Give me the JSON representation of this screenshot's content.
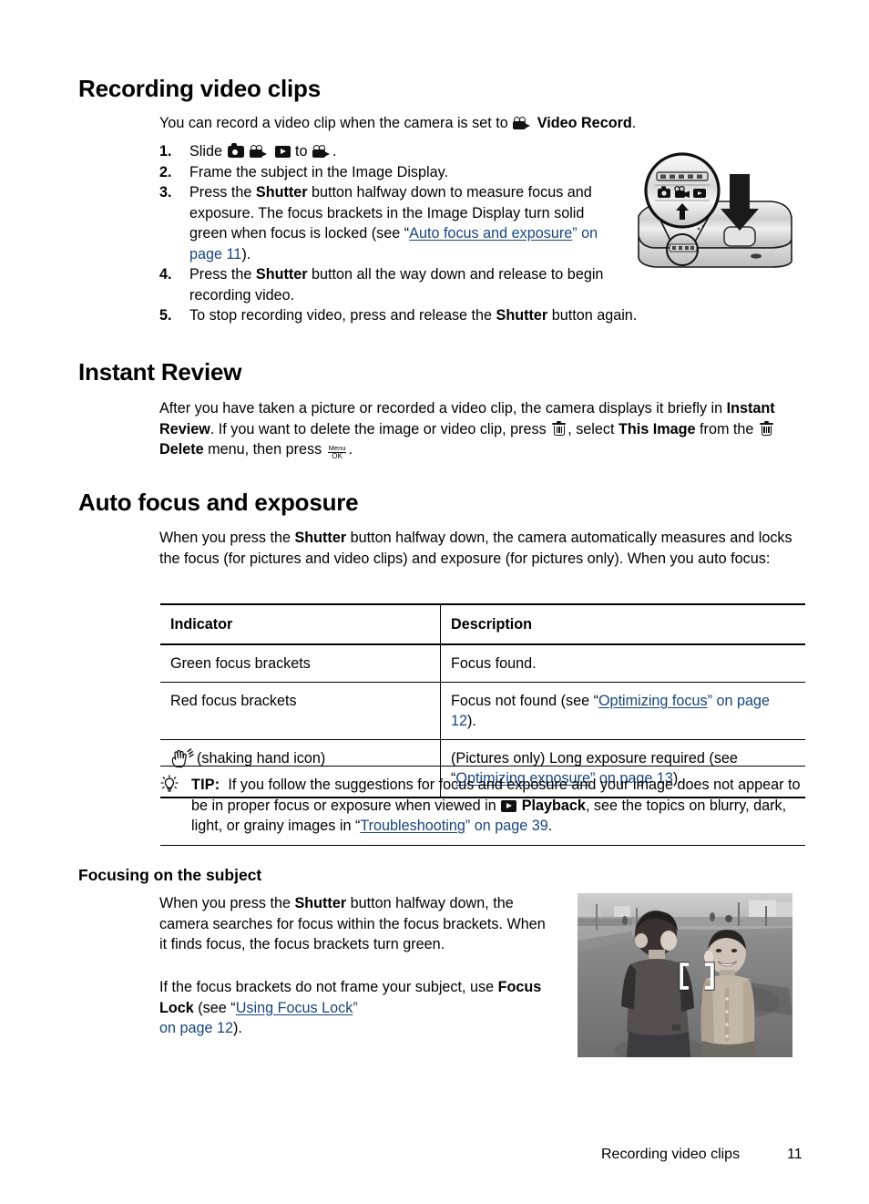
{
  "document": {
    "sections": {
      "recording": {
        "heading": "Recording video clips",
        "intro_pre": "You can record a video clip when the camera is set to ",
        "intro_mode": "Video Record",
        "intro_post": ".",
        "steps": [
          {
            "num": "1.",
            "pre": "Slide ",
            "mid": " to ",
            "post": "."
          },
          {
            "num": "2.",
            "text": "Frame the subject in the Image Display."
          },
          {
            "num": "3.",
            "t1": "Press the ",
            "b1": "Shutter",
            "t2": " button halfway down to measure focus and exposure. The focus brackets in the Image Display turn solid green when focus is locked (see “",
            "link": "Auto focus and exposure",
            "t3": "” on page 11",
            "t4": ")."
          },
          {
            "num": "4.",
            "t1": "Press the ",
            "b1": "Shutter",
            "t2": " button all the way down and release to begin recording video."
          },
          {
            "num": "5.",
            "t1": "To stop recording video, press and release the ",
            "b1": "Shutter",
            "t2": " button again."
          }
        ]
      },
      "instant_review": {
        "heading": "Instant Review",
        "p1_t1": "After you have taken a picture or recorded a video clip, the camera displays it briefly in ",
        "p1_b1": "Instant Review",
        "p1_t2": ". If you want to delete the image or video clip, press ",
        "p1_t3": ", select ",
        "p1_b2": "This Image",
        "p1_t4": " from the ",
        "p1_b3": "Delete",
        "p1_t5": " menu, then press ",
        "p1_t6": "."
      },
      "auto_focus": {
        "heading": "Auto focus and exposure",
        "p1_t1": "When you press the ",
        "p1_b1": "Shutter",
        "p1_t2": " button halfway down, the camera automatically measures and locks the focus (for pictures and video clips) and exposure (for pictures only). When you auto focus:",
        "table": {
          "headers": [
            "Indicator",
            "Description"
          ],
          "rows": [
            {
              "indicator": "Green focus brackets",
              "desc_t1": "Focus found.",
              "desc_link": "",
              "desc_t2": "",
              "desc_t3": ""
            },
            {
              "indicator": "Red focus brackets",
              "desc_t1": "Focus not found (see “",
              "desc_link": "Optimizing focus",
              "desc_t2": "” on page 12",
              "desc_t3": ")."
            },
            {
              "indicator": "(shaking hand icon)",
              "indicator_has_icon": true,
              "desc_t1": "(Pictures only) Long exposure required (see “",
              "desc_link": "Optimizing exposure",
              "desc_t2": "” on page 13",
              "desc_t3": ")."
            }
          ]
        },
        "tip": {
          "label": "TIP:",
          "t1": "If you follow the suggestions for focus and exposure and your image does not appear to be in proper focus or exposure when viewed in ",
          "b1": "Playback",
          "t2": ", see the topics on blurry, dark, light, or grainy images in “",
          "link": "Troubleshooting",
          "t3": "” on page 39",
          "t4": "."
        }
      },
      "focusing": {
        "heading": "Focusing on the subject",
        "p1_t1": "When you press the ",
        "p1_b1": "Shutter",
        "p1_t2": " button halfway down, the camera searches for focus within the focus brackets. When it finds focus, the focus brackets turn green.",
        "p2_t1": "If the focus brackets do not frame your subject, use ",
        "p2_b1": "Focus Lock",
        "p2_t2": " (see “",
        "p2_link": "Using Focus Lock",
        "p2_t3": "”",
        "p2_link2": "on page 12",
        "p2_t4": ")."
      }
    },
    "figures": {
      "camera_diagram": {
        "name": "camera-top-view-with-mode-switch-callout"
      },
      "focus_photo": {
        "name": "two-boys-on-street-with-focus-brackets"
      }
    },
    "footer": {
      "title": "Recording video clips",
      "page_number": "11"
    },
    "colors": {
      "link": "#17457c",
      "text": "#000000",
      "background": "#ffffff"
    }
  }
}
